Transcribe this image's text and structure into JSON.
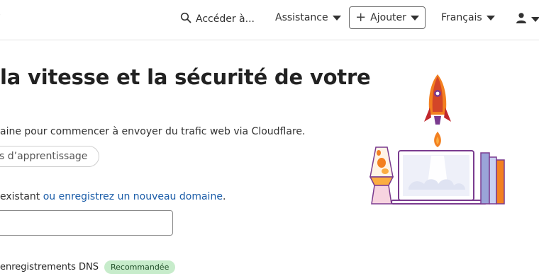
{
  "topbar": {
    "edge_glyph": "ʻ",
    "search_label": "Accéder à...",
    "support_label": "Assistance",
    "add_label": "Ajouter",
    "language_label": "Français"
  },
  "main": {
    "headline": "la vitesse et la sécurité de votre",
    "description": "aine pour commencer à envoyer du trafic web via Cloudflare.",
    "learning_button": "s d’apprentissage",
    "existing_prefix": "existant ",
    "existing_link": "ou enregistrez un nouveau domaine",
    "existing_suffix": ".",
    "domain_input_value": "",
    "dns_label": "enregistrements DNS",
    "dns_badge": "Recommandée"
  },
  "icons": [
    "search-icon",
    "caret-down-icon",
    "plus-icon",
    "user-icon",
    "rocket-laptop-illustration"
  ],
  "colors": {
    "link": "#1a5ca8",
    "badge_bg": "#c7eccb",
    "accent_orange": "#f38020",
    "accent_purple": "#7a3b8f"
  }
}
